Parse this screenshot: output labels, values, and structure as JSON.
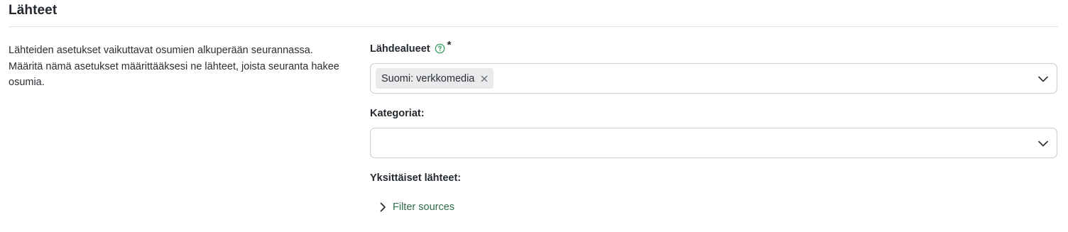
{
  "section": {
    "title": "Lähteet",
    "description": "Lähteiden asetukset vaikuttavat osumien alkuperään seurannassa. Määritä nämä asetukset määrittääksesi ne lähteet, joista seuranta hakee osumia."
  },
  "source_areas": {
    "label": "Lähdealueet",
    "required_mark": "*",
    "help_icon": "question-circle-icon",
    "selected": [
      "Suomi: verkkomedia"
    ],
    "dropdown_icon": "chevron-down-icon"
  },
  "categories": {
    "label": "Kategoriat:",
    "value": "",
    "dropdown_icon": "chevron-down-icon"
  },
  "individual_sources": {
    "label": "Yksittäiset lähteet:",
    "filter_toggle_label": "Filter sources",
    "filter_toggle_icon": "chevron-right-icon"
  },
  "colors": {
    "accent_green": "#2e6b4a",
    "help_icon_green": "#3fa66b"
  }
}
